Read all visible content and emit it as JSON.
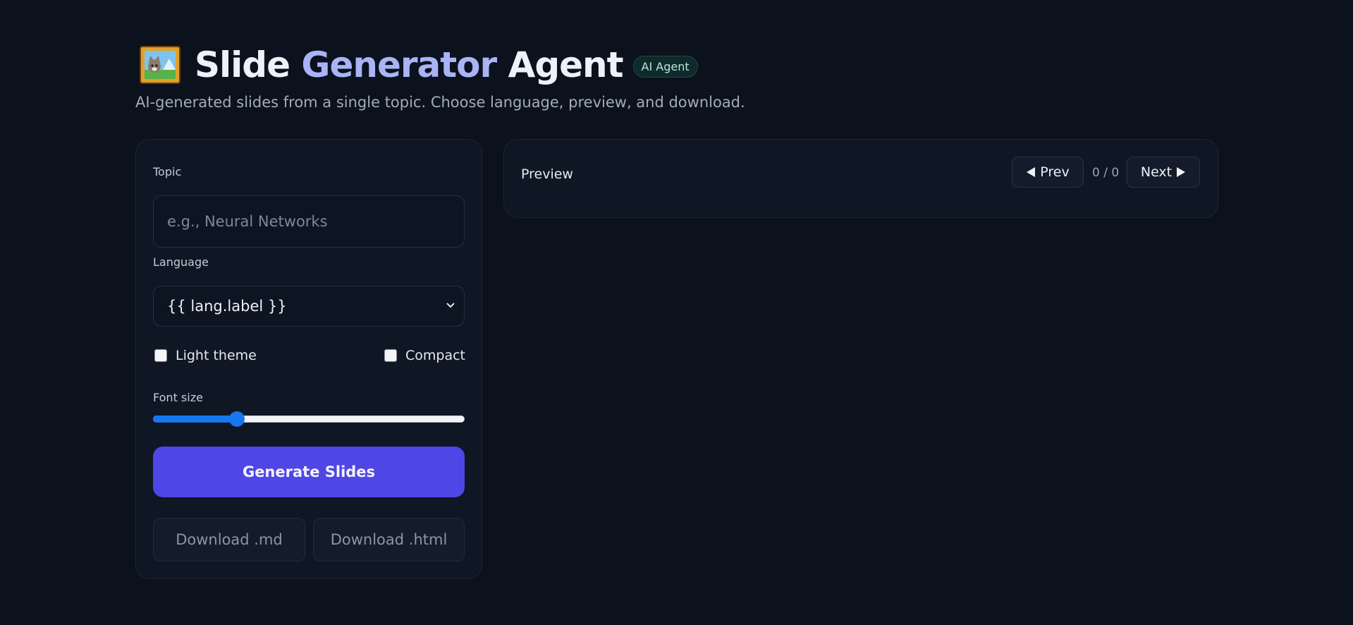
{
  "header": {
    "title_part1": "Slide",
    "title_part2": "Generator",
    "title_part3": "Agent",
    "badge": "AI Agent",
    "subtitle": "AI-generated slides from a single topic. Choose language, preview, and download.",
    "logo_icon": "framed-picture-icon"
  },
  "controls": {
    "topic_label": "Topic",
    "topic_placeholder": "e.g., Neural Networks",
    "topic_value": "",
    "language_label": "Language",
    "language_selected": "{{ lang.label }}",
    "light_theme_label": "Light theme",
    "light_theme_checked": false,
    "compact_label": "Compact",
    "compact_checked": false,
    "font_size_label": "Font size",
    "font_size_fraction": 0.27,
    "generate_label": "Generate Slides",
    "download_md_label": "Download .md",
    "download_html_label": "Download .html"
  },
  "preview": {
    "title": "Preview",
    "prev_label": "Prev",
    "next_label": "Next",
    "counter": "0 / 0"
  },
  "colors": {
    "background": "#0b111d",
    "accent": "#4f46e5",
    "title_highlight": "#a9b4f7",
    "slider": "#1677f0"
  }
}
